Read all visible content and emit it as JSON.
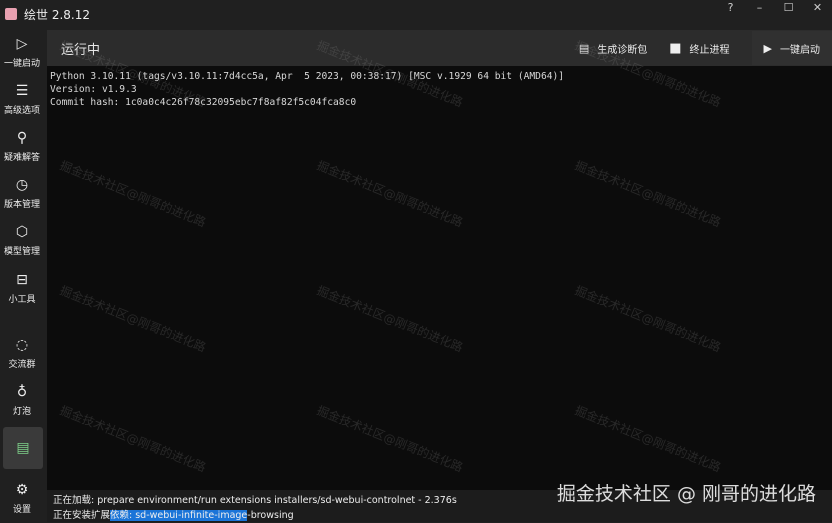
{
  "window": {
    "title": "绘世 2.8.12",
    "help": "?",
    "minimize": "–",
    "maximize": "☐",
    "close": "✕"
  },
  "sidebar": {
    "items": [
      {
        "label": "一键启动",
        "icon": "▷"
      },
      {
        "label": "高级选项",
        "icon": "☰"
      },
      {
        "label": "疑难解答",
        "icon": "⚲"
      },
      {
        "label": "版本管理",
        "icon": "◷"
      },
      {
        "label": "模型管理",
        "icon": "⬡"
      },
      {
        "label": "小工具",
        "icon": "⊟"
      },
      {
        "label": "交流群",
        "icon": "◌"
      },
      {
        "label": "灯泡",
        "icon": "♁"
      },
      {
        "label": "",
        "icon": "▤"
      },
      {
        "label": "设置",
        "icon": "⚙"
      }
    ]
  },
  "header": {
    "title": "运行中",
    "diagnose": "生成诊断包",
    "stop": "终止进程",
    "launch": "一键启动"
  },
  "terminal": {
    "lines": [
      "Python 3.10.11 (tags/v3.10.11:7d4cc5a, Apr  5 2023, 00:38:17) [MSC v.1929 64 bit (AMD64)]",
      "Version: v1.9.3",
      "Commit hash: 1c0a0c4c26f78c32095ebc7f8af82f5c04fca8c0"
    ]
  },
  "status": {
    "line1": "正在加载: prepare environment/run extensions installers/sd-webui-controlnet - 2.376s",
    "line2_pre": "正在安装扩展",
    "line2_hl": "依赖: sd-webui-infinite-image",
    "line2_post": "-browsing"
  },
  "watermark": {
    "text": "掘金技术社区@刚哥的进化路",
    "corner": "掘金技术社区 @ 刚哥的进化路"
  }
}
